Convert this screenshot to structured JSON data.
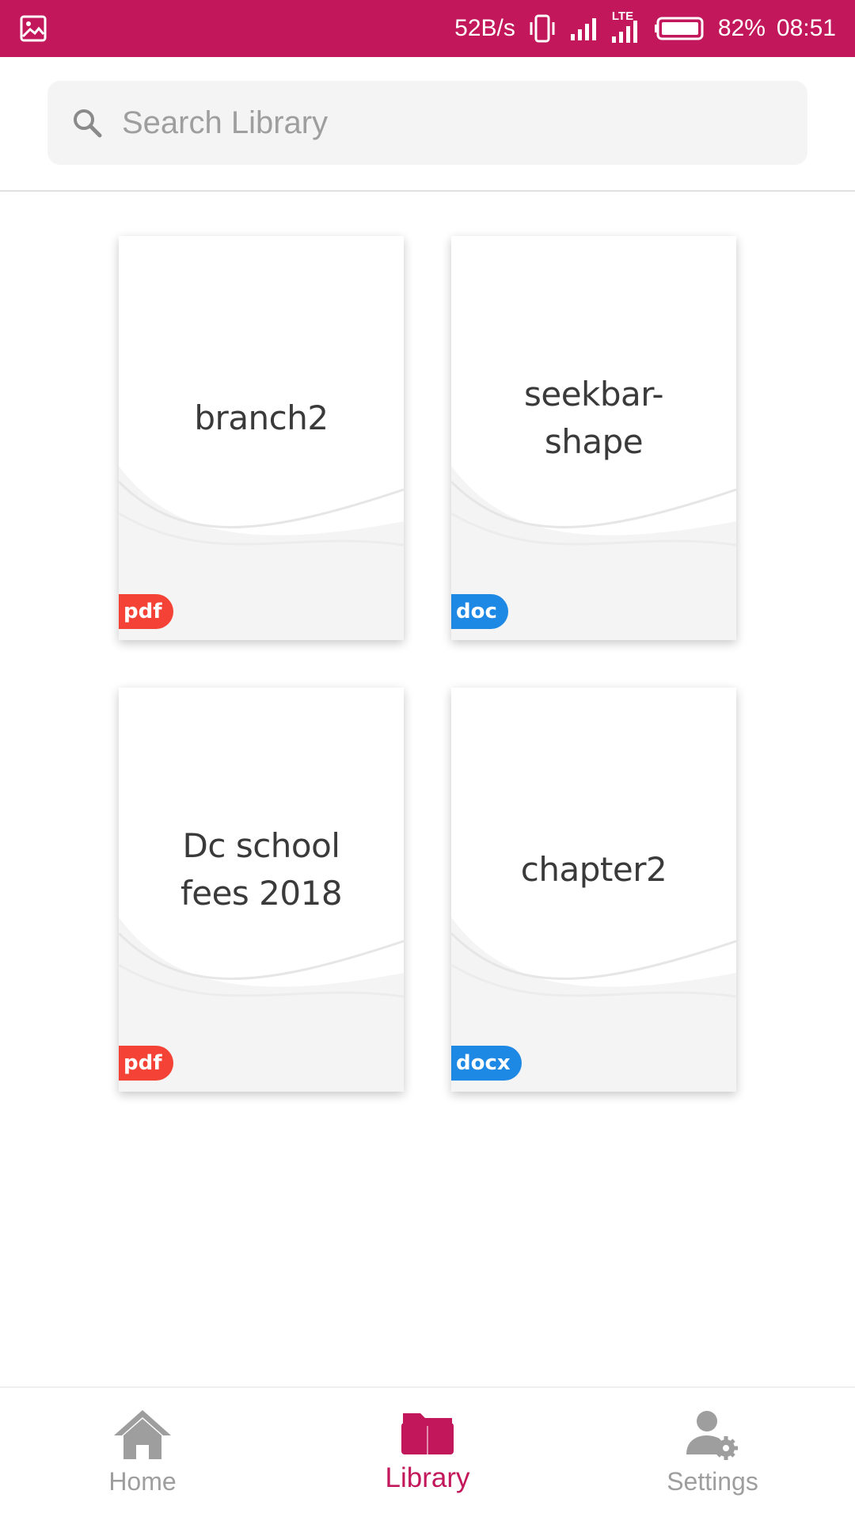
{
  "status_bar": {
    "net_speed": "52B/s",
    "network": "LTE",
    "battery": "82%",
    "time": "08:51",
    "icons": [
      "gallery-icon",
      "vibrate-icon",
      "signal-icon",
      "lte-signal-icon",
      "battery-icon"
    ]
  },
  "search": {
    "placeholder": "Search Library",
    "icon": "search-icon"
  },
  "documents": [
    {
      "title": "branch2",
      "type": "pdf",
      "badge_color": "#f44336"
    },
    {
      "title": "seekbar-\nshape",
      "type": "doc",
      "badge_color": "#1e88e5"
    },
    {
      "title": "Dc school\nfees 2018",
      "type": "pdf",
      "badge_color": "#f44336"
    },
    {
      "title": "chapter2",
      "type": "docx",
      "badge_color": "#1e88e5"
    }
  ],
  "bottom_nav": {
    "items": [
      {
        "label": "Home",
        "icon": "home-icon",
        "active": false
      },
      {
        "label": "Library",
        "icon": "folder-icon",
        "active": true
      },
      {
        "label": "Settings",
        "icon": "user-settings-icon",
        "active": false
      }
    ],
    "active_color": "#c2185b",
    "inactive_color": "#9e9e9e"
  }
}
